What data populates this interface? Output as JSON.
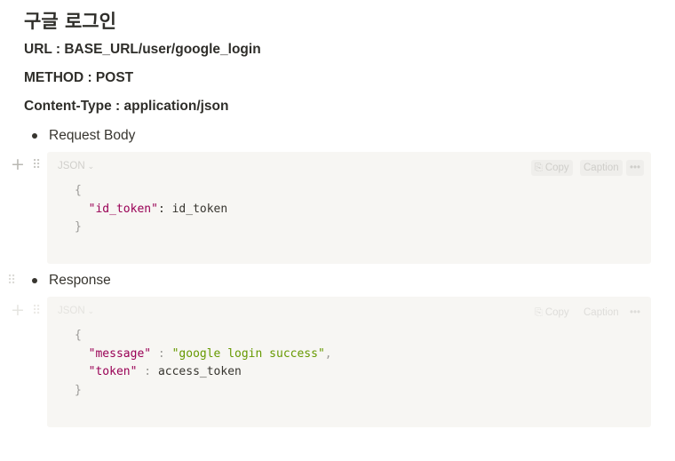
{
  "page": {
    "title": "구글 로그인",
    "url_line": "URL : BASE_URL/user/google_login",
    "method_line": "METHOD : POST",
    "content_type_line": "Content-Type : application/json"
  },
  "sections": [
    {
      "bullet": "Request Body",
      "code": {
        "language": "JSON",
        "copy_label": "Copy",
        "caption_label": "Caption",
        "open_brace": "{",
        "key1": "\"id_token\"",
        "sep1": ": ",
        "val1": "id_token",
        "close_brace": "}"
      }
    },
    {
      "bullet": "Response",
      "code": {
        "language": "JSON",
        "copy_label": "Copy",
        "caption_label": "Caption",
        "open_brace": "{",
        "key1": "\"message\"",
        "sep1": " : ",
        "val1": "\"google login success\"",
        "comma1": ",",
        "key2": "\"token\"",
        "sep2": " : ",
        "val2": "access_token",
        "close_brace": "}"
      }
    }
  ],
  "icons": {
    "add": "plus-icon",
    "drag": "drag-handle-icon",
    "copy": "copy-icon",
    "more": "more-icon"
  },
  "colors": {
    "text": "#37352f",
    "code_bg": "#f7f6f3",
    "json_key": "#990055",
    "json_string": "#669900",
    "punctuation": "#9b9a97"
  }
}
